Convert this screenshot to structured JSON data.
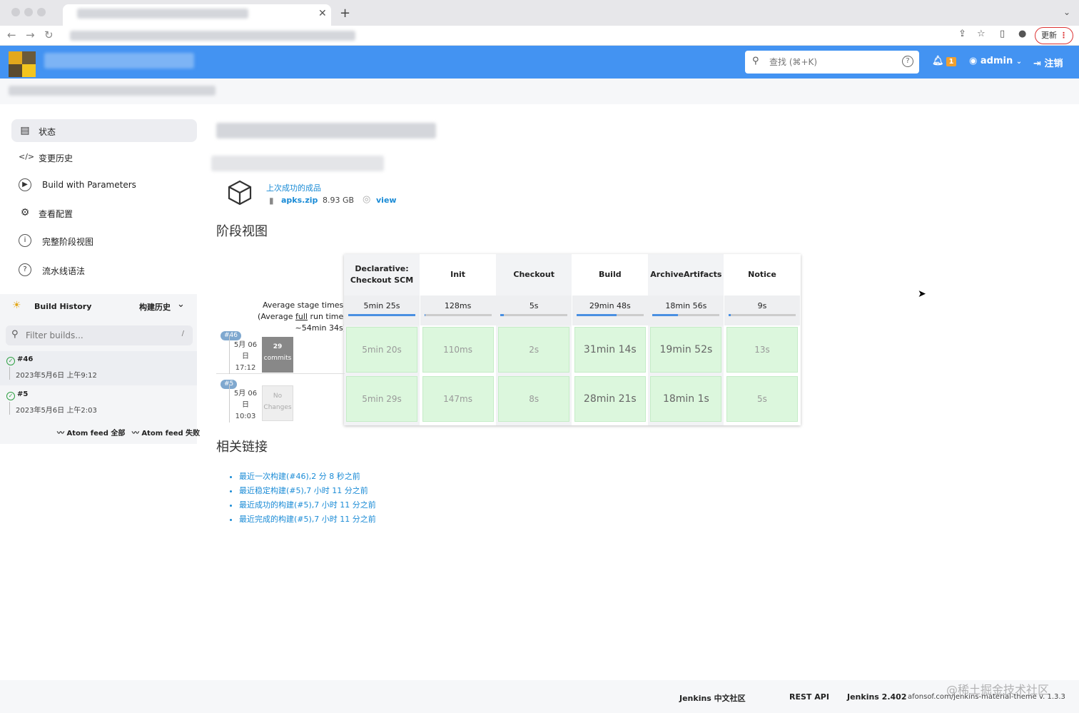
{
  "browser": {
    "update_label": "更新"
  },
  "header": {
    "search_placeholder": "查找 (⌘+K)",
    "notification_count": "1",
    "user": "admin",
    "logout": "注销"
  },
  "sidebar": {
    "items": [
      {
        "label": "状态",
        "icon": "document-icon"
      },
      {
        "label": "变更历史",
        "icon": "code-icon"
      },
      {
        "label": "Build with Parameters",
        "icon": "play-icon"
      },
      {
        "label": "查看配置",
        "icon": "gear-icon"
      },
      {
        "label": "完整阶段视图",
        "icon": "info-icon"
      },
      {
        "label": "流水线语法",
        "icon": "help-icon"
      }
    ],
    "build_history": {
      "title": "Build History",
      "title_cn": "构建历史",
      "filter_placeholder": "Filter builds...",
      "filter_shortcut": "/",
      "builds": [
        {
          "id": "#46",
          "time": "2023年5月6日 上午9:12"
        },
        {
          "id": "#5",
          "time": "2023年5月6日 上午2:03"
        }
      ],
      "atom_all": "Atom feed 全部",
      "atom_fail": "Atom feed 失败"
    }
  },
  "artifacts": {
    "heading": "上次成功的成品",
    "file": "apks.zip",
    "size": "8.93 GB",
    "view": "view"
  },
  "stage_view": {
    "heading": "阶段视图",
    "avg_label": "Average stage times:",
    "avg_full_prefix": "(Average ",
    "avg_full_link": "full",
    "avg_full_suffix": " run time: ~54min 34s)",
    "stages": [
      {
        "name": "Declarative: Checkout SCM",
        "avg": "5min 25s",
        "avg_fill": 1.0
      },
      {
        "name": "Init",
        "avg": "128ms",
        "avg_fill": 0.02
      },
      {
        "name": "Checkout",
        "avg": "5s",
        "avg_fill": 0.05
      },
      {
        "name": "Build",
        "avg": "29min 48s",
        "avg_fill": 0.6
      },
      {
        "name": "ArchiveArtifacts",
        "avg": "18min 56s",
        "avg_fill": 0.38
      },
      {
        "name": "Notice",
        "avg": "9s",
        "avg_fill": 0.03
      }
    ],
    "runs": [
      {
        "badge": "#46",
        "date": "5月 06",
        "day": "日",
        "time": "17:12",
        "changes_count": "29",
        "changes_label": "commits",
        "durations": [
          "5min 20s",
          "110ms",
          "2s",
          "31min 14s",
          "19min 52s",
          "13s"
        ]
      },
      {
        "badge": "#5",
        "date": "5月 06",
        "day": "日",
        "time": "10:03",
        "changes_count": "No",
        "changes_label": "Changes",
        "durations": [
          "5min 29s",
          "147ms",
          "8s",
          "28min 21s",
          "18min 1s",
          "5s"
        ]
      }
    ]
  },
  "related": {
    "heading": "相关链接",
    "links": [
      "最近一次构建(#46),2 分 8 秒之前",
      "最近稳定构建(#5),7 小时 11 分之前",
      "最近成功的构建(#5),7 小时 11 分之前",
      "最近完成的构建(#5),7 小时 11 分之前"
    ]
  },
  "footer": {
    "community": "Jenkins 中文社区",
    "rest_api": "REST API",
    "version": "Jenkins 2.402",
    "theme": "afonsof.com/jenkins-material-theme v. 1.3.3",
    "watermark": "@稀土掘金技术社区"
  },
  "colors": {
    "header_blue": "#4393f2",
    "link_blue": "#1a8bd6",
    "success_green": "#dcf7dd"
  }
}
